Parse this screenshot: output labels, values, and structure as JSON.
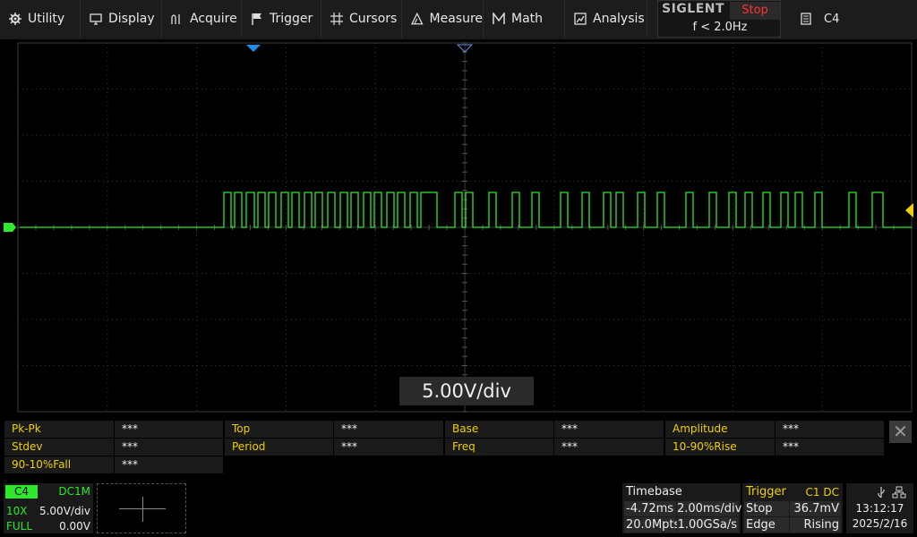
{
  "menu": [
    {
      "label": "Utility",
      "icon": "gear-icon"
    },
    {
      "label": "Display",
      "icon": "monitor-icon"
    },
    {
      "label": "Acquire",
      "icon": "acquire-icon"
    },
    {
      "label": "Trigger",
      "icon": "flag-icon"
    },
    {
      "label": "Cursors",
      "icon": "cursor-crosshair-icon"
    },
    {
      "label": "Measure",
      "icon": "measure-icon"
    },
    {
      "label": "Math",
      "icon": "math-icon"
    },
    {
      "label": "Analysis",
      "icon": "analysis-icon"
    }
  ],
  "brand": {
    "name": "SIGLENT",
    "run_state": "Stop",
    "trigger_frequency": "f < 2.0Hz"
  },
  "document_button": {
    "label": "C4",
    "icon": "document-icon"
  },
  "vertical_scale_readout": "5.00V/div",
  "measurements": [
    {
      "label": "Pk-Pk",
      "value": "***"
    },
    {
      "label": "Top",
      "value": "***"
    },
    {
      "label": "Base",
      "value": "***"
    },
    {
      "label": "Amplitude",
      "value": "***"
    },
    {
      "label": "Stdev",
      "value": "***"
    },
    {
      "label": "Period",
      "value": "***"
    },
    {
      "label": "Freq",
      "value": "***"
    },
    {
      "label": "10-90%Rise",
      "value": "***"
    },
    {
      "label": "90-10%Fall",
      "value": "***"
    }
  ],
  "measurements_close": "✕",
  "channel": {
    "name": "C4",
    "coupling": "DC1M",
    "probe": "10X",
    "scale": "5.00V/div",
    "bandwidth": "FULL",
    "offset": "0.00V",
    "color": "#2ee82e"
  },
  "timebase": {
    "title": "Timebase",
    "delay": "-4.72ms",
    "scale": "2.00ms/div",
    "memory_depth": "20.0Mpts",
    "sample_rate": "1.00GSa/s"
  },
  "trigger": {
    "title": "Trigger",
    "source": "C1 DC",
    "state": "Stop",
    "level": "36.7mV",
    "type": "Edge",
    "slope": "Rising"
  },
  "system": {
    "time": "13:12:17",
    "date": "2025/2/16",
    "icons": [
      "usb-icon",
      "network-icon"
    ]
  },
  "colors": {
    "trace": "#2ee82e",
    "trigger_marker": "#1e8fe8",
    "level_marker": "#f0d000",
    "accent_yellow": "#f0d000",
    "stop_red": "#ff3333"
  }
}
